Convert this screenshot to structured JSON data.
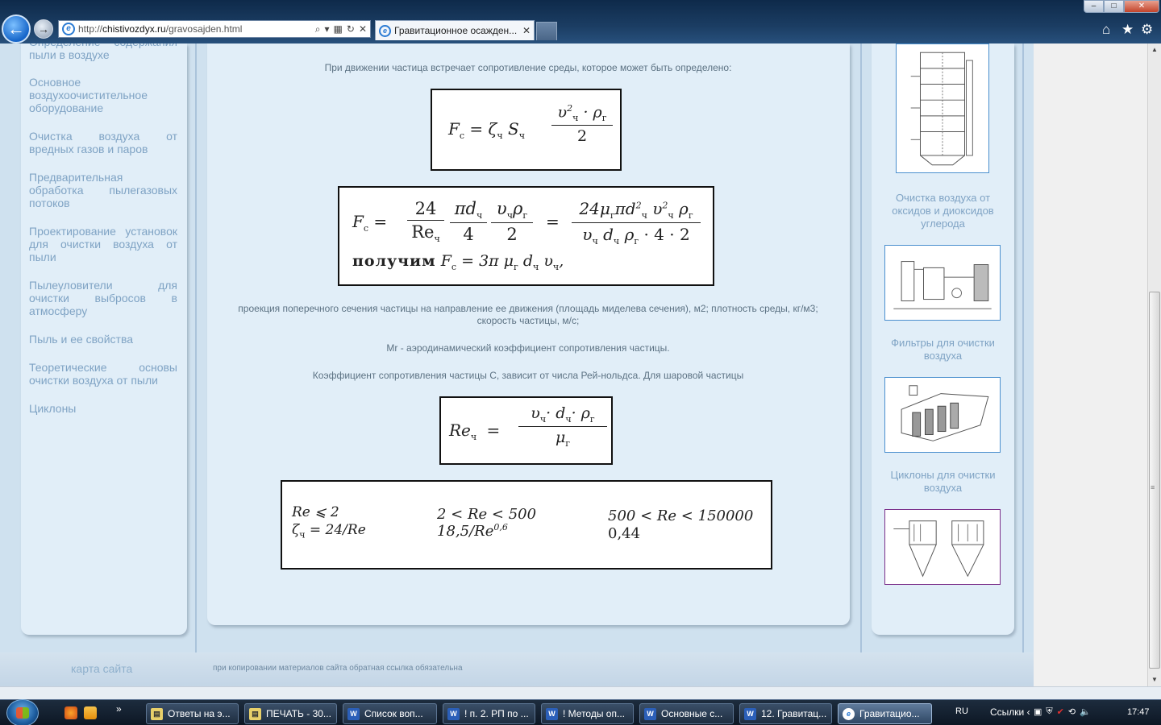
{
  "browser": {
    "url_prefix": "http://",
    "url_domain": "chistivozdyx.ru",
    "url_path": "/gravosajden.html",
    "tab_title": "Гравитационное осажден...",
    "controls": {
      "minimize": "–",
      "maximize": "□",
      "close": "✕"
    }
  },
  "left_nav": {
    "items": [
      "Определение содержания пыли в воздухе",
      "Основное воздухоочистительное оборудование",
      "Очистка воздуха от вредных газов и паров",
      "Предварительная обработка пылегазовых потоков",
      "Проектирование установок для очистки воздуха от пыли",
      "Пылеуловители для очистки выбросов в атмосферу",
      "Пыль и ее свойства",
      "Теоретические основы очистки воздуха от пыли",
      "Циклоны"
    ]
  },
  "main": {
    "para1": "При движении частица встречает сопротивление среды, которое может быть определено:",
    "f1": {
      "lhs": "F",
      "lhs_sub": "с",
      "rhs": "= ζ",
      "rhs_sub1": "ч",
      "s": "S",
      "s_sub": "ч",
      "num": "υ",
      "num_sup": "2",
      "num_sub": "ч",
      "num_rest": "· ρ",
      "num_rest_sub": "г",
      "den": "2"
    },
    "f2": {
      "lhs": "F",
      "lhs_sub": "с",
      "eq": "=",
      "frac1_num": "24",
      "frac1_den": "Re",
      "frac1_den_sub": "ч",
      "frac2_num": "πd",
      "frac2_num_sub": "ч",
      "frac2_den": "4",
      "frac3_num": "υ",
      "frac3_num_sub": "ч",
      "frac3_num_rest": "ρ",
      "frac3_num_rest_sub": "г",
      "frac3_den": "2",
      "eq2": "=",
      "frac4_num": "24μ",
      "frac4_num_sub": "г",
      "frac4_num_b": "πd",
      "frac4_num_b_sup": "2",
      "frac4_num_b_sub": "ч",
      "frac4_num_c": "υ",
      "frac4_num_c_sup": "2",
      "frac4_num_c_sub": "ч",
      "frac4_num_d": "ρ",
      "frac4_num_d_sub": "г",
      "frac4_den": "υ",
      "frac4_den_sub": "ч",
      "frac4_den_b": "d",
      "frac4_den_b_sub": "ч",
      "frac4_den_c": "ρ",
      "frac4_den_c_sub": "г",
      "frac4_den_d": "· 4 · 2",
      "line2_word": "получим",
      "line2_f": "F",
      "line2_f_sub": "с",
      "line2_rhs": "= 3π μ",
      "line2_rhs_sub": "г",
      "line2_d": "d",
      "line2_d_sub": "ч",
      "line2_v": "υ",
      "line2_v_sub": "ч",
      "line2_end": ","
    },
    "para2": "проекция поперечного сечения частицы на направление ее движения (площадь миделева сечения), м2; плотность среды, кг/м3; скорость частицы, м/с;",
    "para3": "Mr - аэродинамический коэффициент сопротивления частицы.",
    "para4": "Коэффициент сопротивления частицы С, зависит от числа Рей-нольдса. Для шаровой частицы",
    "f3": {
      "lhs": "Re",
      "lhs_sub": "ч",
      "eq": "=",
      "num": "υ",
      "num_sub": "ч",
      "num_b": "· d",
      "num_b_sub": "ч",
      "num_c": "· ρ",
      "num_c_sub": "г",
      "den": "μ",
      "den_sub": "г"
    },
    "f4": {
      "c1_r1": "Re  ⩽  2",
      "c1_r2a": "ζ",
      "c1_r2_sub": "ч",
      "c1_r2b": "= 24/Re",
      "c2_r1": "2 < Re < 500",
      "c2_r2": "18,5/Re",
      "c2_r2_sup": "0,6",
      "c3_r1": "500 < Re < 150000",
      "c3_r2": "0,44"
    }
  },
  "right_side": {
    "links": [
      "Очистка воздуха от оксидов и диоксидов углерода",
      "Фильтры для очистки воздуха",
      "Циклоны для очистки воздуха"
    ],
    "accent": "#4a8fce",
    "selected_border": "#7a2f8a"
  },
  "footer": {
    "sitemap": "карта сайта",
    "copy": "при копировании материалов сайта обратная ссылка обязательна"
  },
  "taskbar": {
    "tasks": [
      "Ответы на э...",
      "ПЕЧАТЬ - 30...",
      "Список воп...",
      "! п. 2. РП по ...",
      "!  Методы оп...",
      "Основные с...",
      "12. Гравитац...",
      "Гравитацио..."
    ],
    "lang": "RU",
    "links": "Ссылки",
    "clock": "17:47"
  }
}
